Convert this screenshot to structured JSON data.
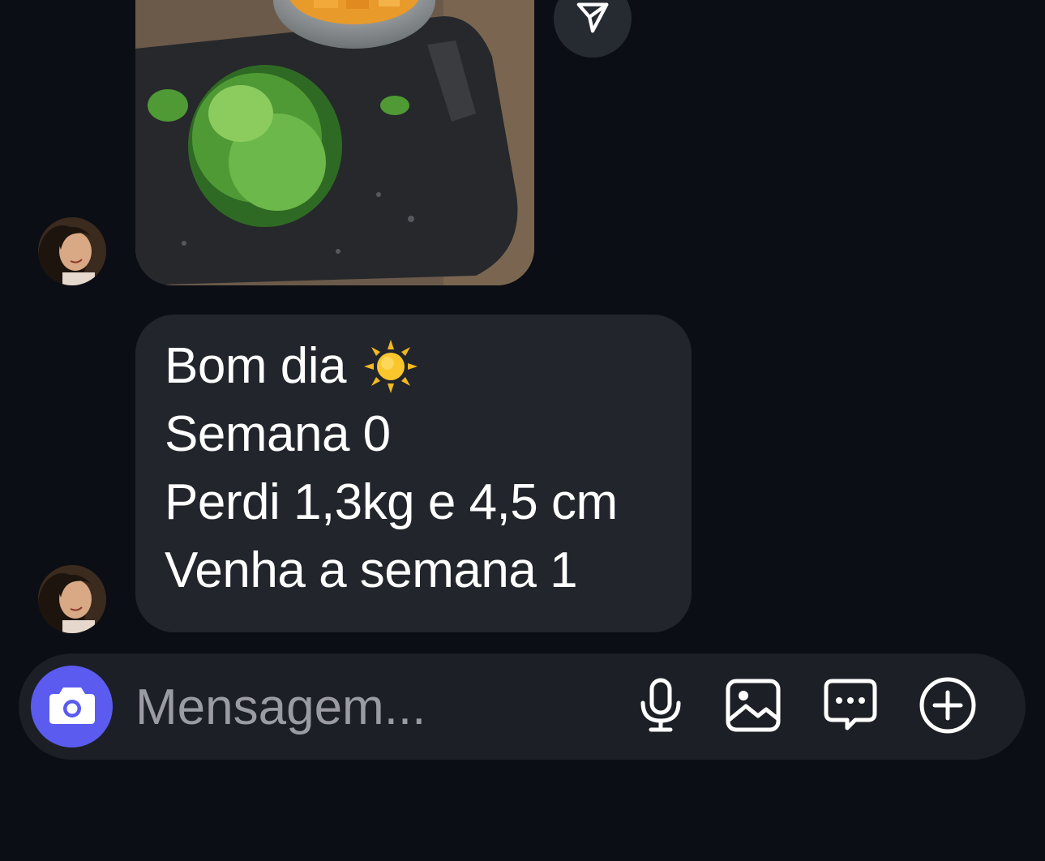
{
  "thread": {
    "photo_message": {
      "image": "photo-chopped-greens-on-cutting-board",
      "share_icon": "paper-plane-icon"
    },
    "avatar": "sender-avatar-woman",
    "text_message": {
      "lines": [
        "Bom dia",
        "Semana 0",
        "Perdi 1,3kg e 4,5 cm",
        "Venha a semana 1"
      ],
      "emoji": "sun-icon"
    }
  },
  "composer": {
    "placeholder": "Mensagem...",
    "camera_icon": "camera-icon",
    "tools": [
      "microphone-icon",
      "gallery-icon",
      "sticker-chat-icon",
      "plus-circle-icon"
    ]
  },
  "colors": {
    "background": "#0b0e14",
    "bubble": "#22252b",
    "composer": "#1c1f25",
    "accent": "#5b5bf0",
    "placeholder": "#9a9ba3"
  }
}
